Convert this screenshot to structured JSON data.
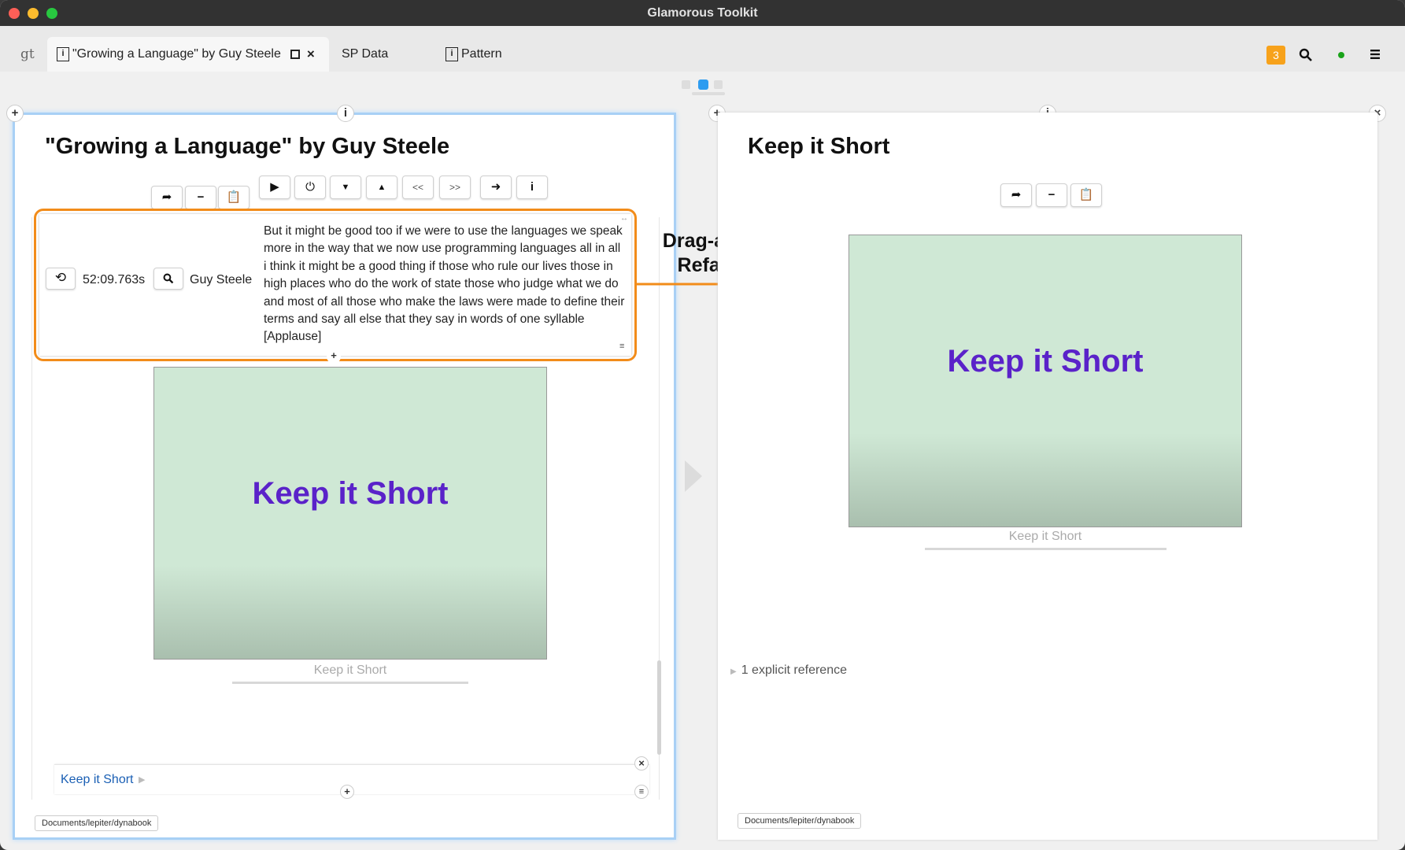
{
  "window": {
    "title": "Glamorous Toolkit"
  },
  "tabs": {
    "logo": "gt",
    "tab1_label": "\"Growing a Language\" by Guy Steele",
    "tab2_label": "SP Data",
    "tab3_label": "Pattern",
    "page_icon_glyph": "i",
    "notification_count": "3"
  },
  "left": {
    "title": "\"Growing a Language\" by Guy Steele",
    "snippet": {
      "timestamp": "52:09.763s",
      "speaker": "Guy Steele",
      "text": "But it might be good too if we were to use the languages we speak more in the way that we now use programming languages all in all i think it might be a good thing if those who rule our lives those in high places who do the work of state those who judge what we do and most of all those who make the laws were made to define their terms and say all else that they say in words of one syllable [Applause]"
    },
    "slide_text": "Keep it Short",
    "caption": "Keep it Short",
    "link_label": "Keep it Short",
    "path": "Documents/lepiter/dynabook"
  },
  "annotation": {
    "line1": "Drag-and-Drop",
    "line2": "Refactoring"
  },
  "right": {
    "title": "Keep it Short",
    "slide_text": "Keep it Short",
    "caption": "Keep it Short",
    "references": "1 explicit reference",
    "path": "Documents/lepiter/dynabook"
  },
  "toolbar": {
    "prev_label": "<<",
    "next_label": ">>",
    "info_label": "i"
  },
  "colors": {
    "accent_orange": "#f28c1a",
    "slide_text_purple": "#5a22c9",
    "pane_focus_blue": "#a8d0f5",
    "link_blue": "#1a5fb4",
    "notification_orange": "#f7a21b"
  }
}
